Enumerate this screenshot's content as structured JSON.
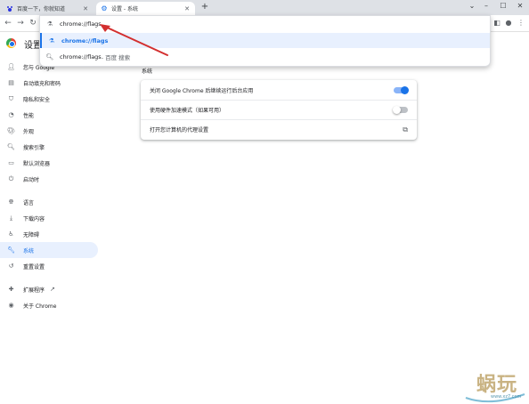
{
  "tabs": [
    {
      "label": "百度一下，你就知道",
      "icon": "baidu-paw-icon",
      "active": false
    },
    {
      "label": "设置 - 系统",
      "icon": "gear-icon",
      "active": true
    }
  ],
  "omnibox": {
    "input_text": "chrome://flags",
    "suggestions": [
      {
        "text": "chrome://flags",
        "icon": "flask-icon",
        "selected": true
      },
      {
        "text": "chrome://flags",
        "subtext": " - 百度 搜索",
        "icon": "search-icon",
        "selected": false
      }
    ]
  },
  "settings": {
    "title": "设置",
    "nav": [
      {
        "label": "您与 Google",
        "icon": "person-icon"
      },
      {
        "label": "自动填充和密码",
        "icon": "clipboard-icon"
      },
      {
        "label": "隐私和安全",
        "icon": "shield-icon"
      },
      {
        "label": "性能",
        "icon": "speedometer-icon"
      },
      {
        "label": "外观",
        "icon": "palette-icon"
      },
      {
        "label": "搜索引擎",
        "icon": "search-icon"
      },
      {
        "label": "默认浏览器",
        "icon": "browser-icon"
      },
      {
        "label": "启动时",
        "icon": "power-icon"
      },
      {
        "label": "语言",
        "icon": "globe-icon"
      },
      {
        "label": "下载内容",
        "icon": "download-icon"
      },
      {
        "label": "无障碍",
        "icon": "accessibility-icon"
      },
      {
        "label": "系统",
        "icon": "wrench-icon",
        "active": true
      },
      {
        "label": "重置设置",
        "icon": "reset-icon"
      },
      {
        "label": "扩展程序",
        "icon": "puzzle-icon"
      },
      {
        "label": "关于 Chrome",
        "icon": "chrome-icon"
      }
    ],
    "section_title": "系统",
    "rows": [
      {
        "label": "关闭 Google Chrome 后继续运行后台应用",
        "control": "toggle",
        "on": true
      },
      {
        "label": "使用硬件加速模式（如果可用）",
        "control": "toggle",
        "on": false
      },
      {
        "label": "打开您计算机的代理设置",
        "control": "launch-icon"
      }
    ]
  },
  "watermark": {
    "text": "蜗玩",
    "url": "www.xz7.com"
  },
  "colors": {
    "accent": "#1a73e8",
    "arrow": "#d32f2f",
    "selected_bg": "#e8f0fe"
  }
}
